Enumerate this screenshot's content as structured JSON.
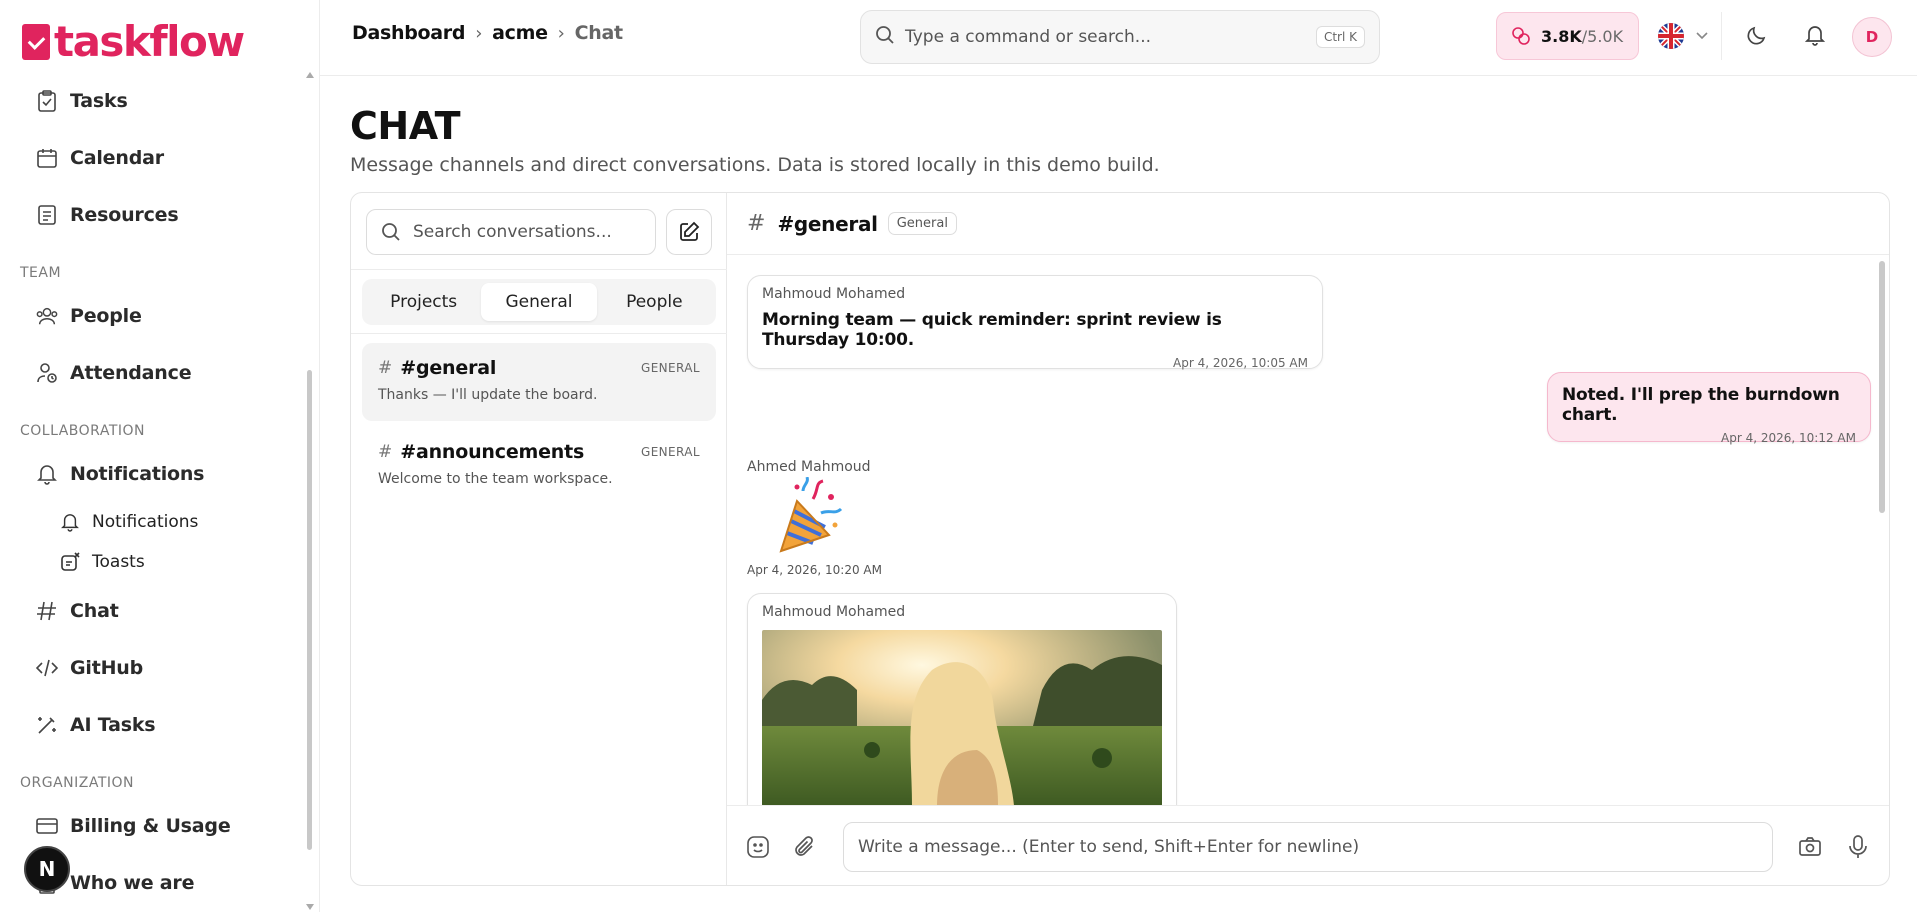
{
  "app": {
    "logo_text": "taskflow",
    "brand_color": "#e0245e"
  },
  "sidebar": {
    "items_top": [
      {
        "label": "Tasks",
        "icon": "clipboard-check-icon"
      },
      {
        "label": "Calendar",
        "icon": "calendar-icon"
      },
      {
        "label": "Resources",
        "icon": "document-icon"
      }
    ],
    "section_team": "TEAM",
    "items_team": [
      {
        "label": "People",
        "icon": "users-icon"
      },
      {
        "label": "Attendance",
        "icon": "user-clock-icon"
      }
    ],
    "section_collab": "COLLABORATION",
    "notifications_label": "Notifications",
    "sub_notifications": "Notifications",
    "sub_toasts": "Toasts",
    "items_collab": [
      {
        "label": "Chat",
        "icon": "hash-chat-icon"
      },
      {
        "label": "GitHub",
        "icon": "code-icon"
      },
      {
        "label": "AI Tasks",
        "icon": "magic-wand-icon"
      }
    ],
    "section_org": "ORGANIZATION",
    "billing_label": "Billing & Usage",
    "who_label": "Who we are",
    "floating_badge": "N"
  },
  "header": {
    "breadcrumb": [
      "Dashboard",
      "acme",
      "Chat"
    ],
    "search_placeholder": "Type a command or search...",
    "search_shortcut": "Ctrl K",
    "usage_used": "3.8K",
    "usage_limit": "/5.0K",
    "avatar_initial": "D"
  },
  "page": {
    "title": "CHAT",
    "subtitle": "Message channels and direct conversations. Data is stored locally in this demo build."
  },
  "chat": {
    "search_placeholder": "Search conversations...",
    "tabs": [
      "Projects",
      "General",
      "People"
    ],
    "active_tab": "General",
    "conversations": [
      {
        "name": "#general",
        "tag": "GENERAL",
        "preview": "Thanks — I'll update the board."
      },
      {
        "name": "#announcements",
        "tag": "GENERAL",
        "preview": "Welcome to the team workspace."
      }
    ],
    "active_channel": {
      "name": "#general",
      "badge": "General"
    },
    "messages": [
      {
        "sender": "Mahmoud Mohamed",
        "text": "Morning team — quick reminder: sprint review is Thursday 10:00.",
        "time": "Apr 4, 2026, 10:05 AM"
      },
      {
        "sender": "",
        "text": "Noted. I'll prep the burndown chart.",
        "time": "Apr 4, 2026, 10:12 AM"
      },
      {
        "sender": "Ahmed Mahmoud",
        "text": "🎉",
        "time": "Apr 4, 2026, 10:20 AM"
      },
      {
        "sender": "Mahmoud Mohamed",
        "text": "",
        "time": ""
      }
    ],
    "composer_placeholder": "Write a message... (Enter to send, Shift+Enter for newline)"
  }
}
